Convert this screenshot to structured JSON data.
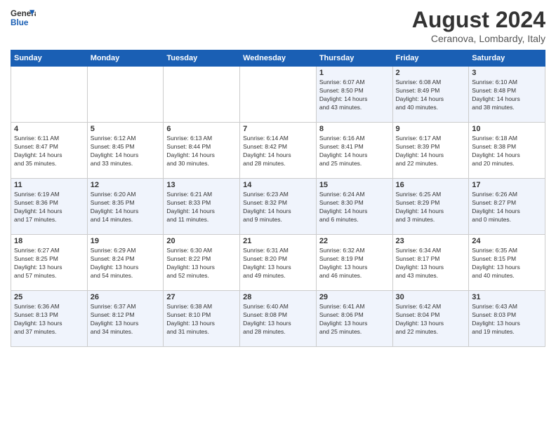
{
  "header": {
    "logo_line1": "General",
    "logo_line2": "Blue",
    "month_year": "August 2024",
    "location": "Ceranova, Lombardy, Italy"
  },
  "days_of_week": [
    "Sunday",
    "Monday",
    "Tuesday",
    "Wednesday",
    "Thursday",
    "Friday",
    "Saturday"
  ],
  "weeks": [
    [
      {
        "day": "",
        "info": ""
      },
      {
        "day": "",
        "info": ""
      },
      {
        "day": "",
        "info": ""
      },
      {
        "day": "",
        "info": ""
      },
      {
        "day": "1",
        "info": "Sunrise: 6:07 AM\nSunset: 8:50 PM\nDaylight: 14 hours\nand 43 minutes."
      },
      {
        "day": "2",
        "info": "Sunrise: 6:08 AM\nSunset: 8:49 PM\nDaylight: 14 hours\nand 40 minutes."
      },
      {
        "day": "3",
        "info": "Sunrise: 6:10 AM\nSunset: 8:48 PM\nDaylight: 14 hours\nand 38 minutes."
      }
    ],
    [
      {
        "day": "4",
        "info": "Sunrise: 6:11 AM\nSunset: 8:47 PM\nDaylight: 14 hours\nand 35 minutes."
      },
      {
        "day": "5",
        "info": "Sunrise: 6:12 AM\nSunset: 8:45 PM\nDaylight: 14 hours\nand 33 minutes."
      },
      {
        "day": "6",
        "info": "Sunrise: 6:13 AM\nSunset: 8:44 PM\nDaylight: 14 hours\nand 30 minutes."
      },
      {
        "day": "7",
        "info": "Sunrise: 6:14 AM\nSunset: 8:42 PM\nDaylight: 14 hours\nand 28 minutes."
      },
      {
        "day": "8",
        "info": "Sunrise: 6:16 AM\nSunset: 8:41 PM\nDaylight: 14 hours\nand 25 minutes."
      },
      {
        "day": "9",
        "info": "Sunrise: 6:17 AM\nSunset: 8:39 PM\nDaylight: 14 hours\nand 22 minutes."
      },
      {
        "day": "10",
        "info": "Sunrise: 6:18 AM\nSunset: 8:38 PM\nDaylight: 14 hours\nand 20 minutes."
      }
    ],
    [
      {
        "day": "11",
        "info": "Sunrise: 6:19 AM\nSunset: 8:36 PM\nDaylight: 14 hours\nand 17 minutes."
      },
      {
        "day": "12",
        "info": "Sunrise: 6:20 AM\nSunset: 8:35 PM\nDaylight: 14 hours\nand 14 minutes."
      },
      {
        "day": "13",
        "info": "Sunrise: 6:21 AM\nSunset: 8:33 PM\nDaylight: 14 hours\nand 11 minutes."
      },
      {
        "day": "14",
        "info": "Sunrise: 6:23 AM\nSunset: 8:32 PM\nDaylight: 14 hours\nand 9 minutes."
      },
      {
        "day": "15",
        "info": "Sunrise: 6:24 AM\nSunset: 8:30 PM\nDaylight: 14 hours\nand 6 minutes."
      },
      {
        "day": "16",
        "info": "Sunrise: 6:25 AM\nSunset: 8:29 PM\nDaylight: 14 hours\nand 3 minutes."
      },
      {
        "day": "17",
        "info": "Sunrise: 6:26 AM\nSunset: 8:27 PM\nDaylight: 14 hours\nand 0 minutes."
      }
    ],
    [
      {
        "day": "18",
        "info": "Sunrise: 6:27 AM\nSunset: 8:25 PM\nDaylight: 13 hours\nand 57 minutes."
      },
      {
        "day": "19",
        "info": "Sunrise: 6:29 AM\nSunset: 8:24 PM\nDaylight: 13 hours\nand 54 minutes."
      },
      {
        "day": "20",
        "info": "Sunrise: 6:30 AM\nSunset: 8:22 PM\nDaylight: 13 hours\nand 52 minutes."
      },
      {
        "day": "21",
        "info": "Sunrise: 6:31 AM\nSunset: 8:20 PM\nDaylight: 13 hours\nand 49 minutes."
      },
      {
        "day": "22",
        "info": "Sunrise: 6:32 AM\nSunset: 8:19 PM\nDaylight: 13 hours\nand 46 minutes."
      },
      {
        "day": "23",
        "info": "Sunrise: 6:34 AM\nSunset: 8:17 PM\nDaylight: 13 hours\nand 43 minutes."
      },
      {
        "day": "24",
        "info": "Sunrise: 6:35 AM\nSunset: 8:15 PM\nDaylight: 13 hours\nand 40 minutes."
      }
    ],
    [
      {
        "day": "25",
        "info": "Sunrise: 6:36 AM\nSunset: 8:13 PM\nDaylight: 13 hours\nand 37 minutes."
      },
      {
        "day": "26",
        "info": "Sunrise: 6:37 AM\nSunset: 8:12 PM\nDaylight: 13 hours\nand 34 minutes."
      },
      {
        "day": "27",
        "info": "Sunrise: 6:38 AM\nSunset: 8:10 PM\nDaylight: 13 hours\nand 31 minutes."
      },
      {
        "day": "28",
        "info": "Sunrise: 6:40 AM\nSunset: 8:08 PM\nDaylight: 13 hours\nand 28 minutes."
      },
      {
        "day": "29",
        "info": "Sunrise: 6:41 AM\nSunset: 8:06 PM\nDaylight: 13 hours\nand 25 minutes."
      },
      {
        "day": "30",
        "info": "Sunrise: 6:42 AM\nSunset: 8:04 PM\nDaylight: 13 hours\nand 22 minutes."
      },
      {
        "day": "31",
        "info": "Sunrise: 6:43 AM\nSunset: 8:03 PM\nDaylight: 13 hours\nand 19 minutes."
      }
    ]
  ]
}
